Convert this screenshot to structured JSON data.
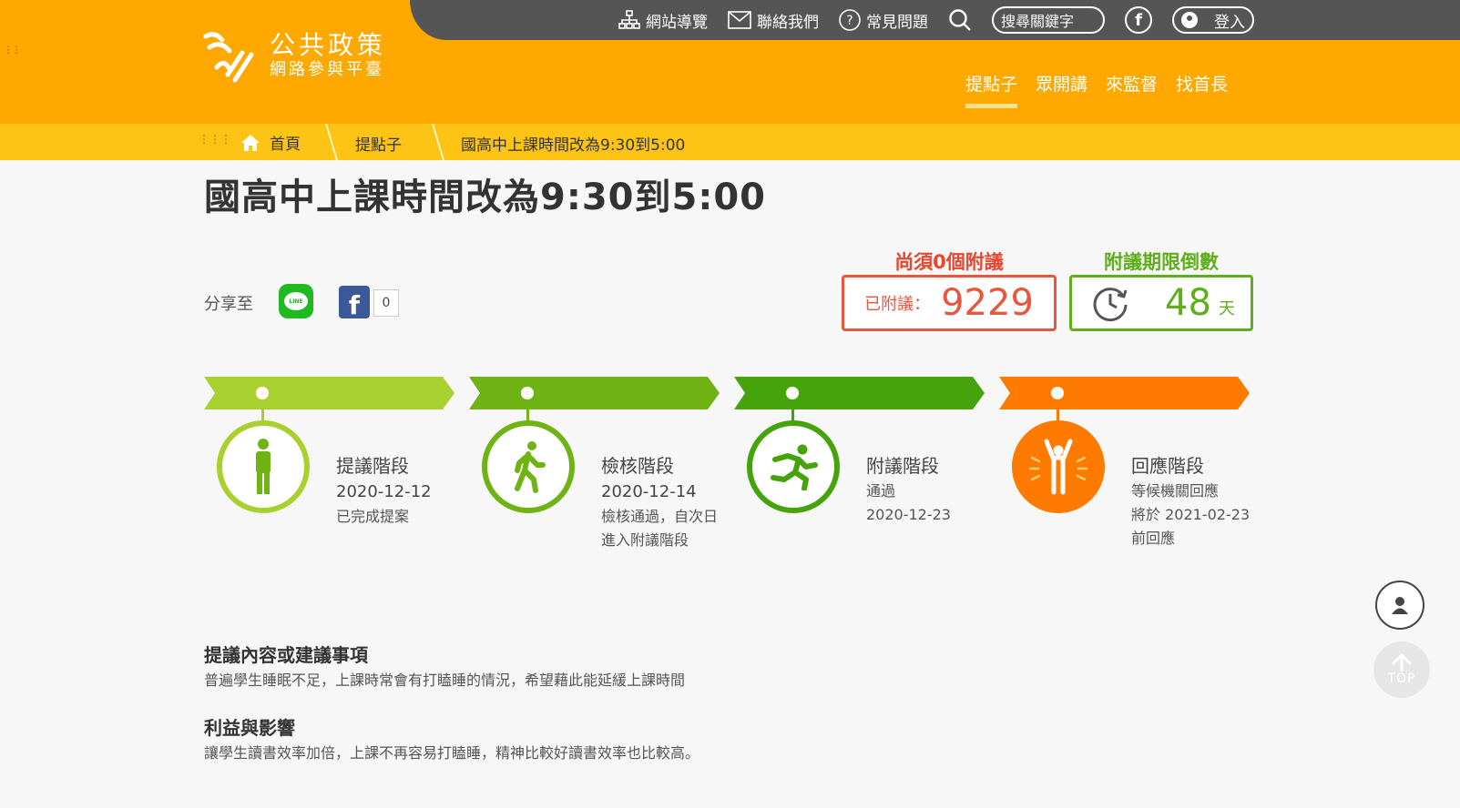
{
  "topbar": {
    "sitemap": "網站導覽",
    "contact": "聯絡我們",
    "faq": "常見問題",
    "search_placeholder": "搜尋關鍵字",
    "login": "登入"
  },
  "logo": {
    "title": "公共政策",
    "subtitle": "網路參與平臺"
  },
  "mainnav": [
    {
      "label": "提點子",
      "active": true
    },
    {
      "label": "眾開講"
    },
    {
      "label": "來監督"
    },
    {
      "label": "找首長"
    }
  ],
  "breadcrumb": {
    "home": "首頁",
    "section": "提點子",
    "current": "國高中上課時間改為9:30到5:00"
  },
  "proposal": {
    "title": "國高中上課時間改為9:30到5:00"
  },
  "share": {
    "label": "分享至",
    "line_text": "LINE",
    "fb_count": "0"
  },
  "stats": {
    "need_label": "尚須0個附議",
    "seconded_label": "已附議：",
    "seconded_value": "9229",
    "countdown_label": "附議期限倒數",
    "countdown_value": "48",
    "countdown_unit": "天"
  },
  "stages": [
    {
      "title": "提議階段",
      "line1": "2020-12-12",
      "line2": "已完成提案",
      "color": "#a8d130",
      "icon": "standing-person-icon"
    },
    {
      "title": "檢核階段",
      "line1": "2020-12-14",
      "line2": "檢核通過，自次日進入附議階段",
      "color": "#6fb315",
      "icon": "walking-person-icon"
    },
    {
      "title": "附議階段",
      "line1": "通過",
      "line2": "2020-12-23",
      "color": "#46a30c",
      "icon": "running-person-icon"
    },
    {
      "title": "回應階段",
      "line1": "等候機關回應",
      "line2": "將於 2021-02-23 前回應",
      "color": "#ff7a00",
      "icon": "cheering-person-icon"
    }
  ],
  "content": {
    "section1_title": "提議內容或建議事項",
    "section1_body": "普遍學生睡眠不足，上課時常會有打瞌睡的情況，希望藉此能延緩上課時間",
    "section2_title": "利益與影響",
    "section2_body": "讓學生讀書效率加倍，上課不再容易打瞌睡，精神比較好讀書效率也比較高。"
  },
  "float": {
    "top_label": "TOP"
  }
}
